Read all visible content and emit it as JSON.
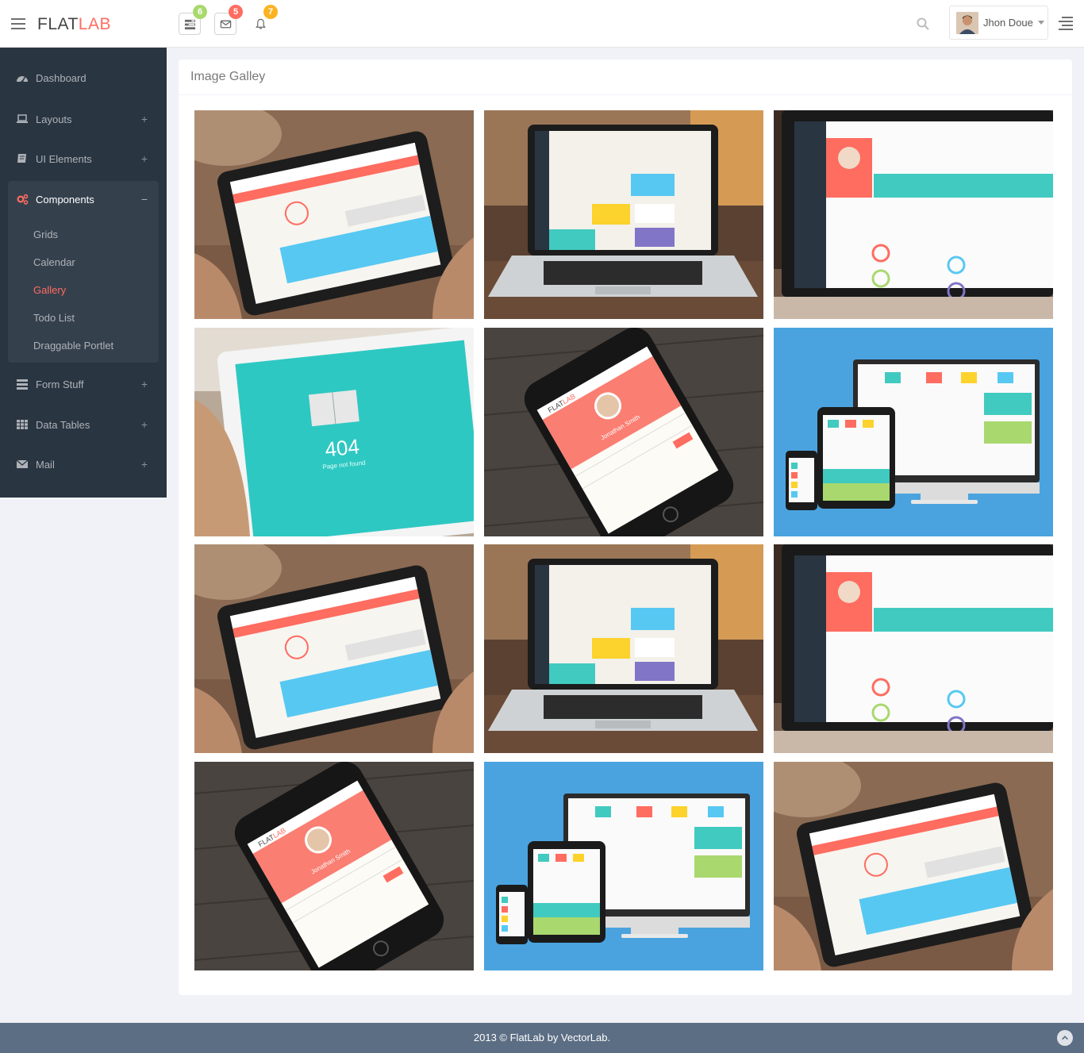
{
  "header": {
    "logo_main": "FLAT",
    "logo_accent": "LAB",
    "notifications": [
      {
        "icon": "tasks-icon",
        "count": "6",
        "color": "#a9d86e"
      },
      {
        "icon": "envelope-icon",
        "count": "5",
        "color": "#ff6c60"
      },
      {
        "icon": "bell-icon",
        "count": "7",
        "color": "#fcb322"
      }
    ],
    "user_name": "Jhon Doue"
  },
  "sidebar": {
    "items": [
      {
        "label": "Dashboard",
        "icon": "dashboard-icon"
      },
      {
        "label": "Layouts",
        "icon": "laptop-icon",
        "expander": "+"
      },
      {
        "label": "UI Elements",
        "icon": "book-icon",
        "expander": "+"
      },
      {
        "label": "Components",
        "icon": "cogs-icon",
        "expander": "−"
      },
      {
        "label": "Form Stuff",
        "icon": "tasks-icon",
        "expander": "+"
      },
      {
        "label": "Data Tables",
        "icon": "table-icon",
        "expander": "+"
      },
      {
        "label": "Mail",
        "icon": "envelope-icon",
        "expander": "+"
      }
    ],
    "components_sub": [
      "Grids",
      "Calendar",
      "Gallery",
      "Todo List",
      "Draggable Portlet"
    ],
    "active_sub": "Gallery"
  },
  "main": {
    "panel_title": "Image Galley",
    "gallery": [
      {
        "type": "tablet-hands"
      },
      {
        "type": "laptop-desk"
      },
      {
        "type": "laptop-profile"
      },
      {
        "type": "tablet-404",
        "text_main": "404",
        "text_sub": "Page not found"
      },
      {
        "type": "phone-profile",
        "person": "Jonathan Smith",
        "logo_main": "FLAT",
        "logo_accent": "LAB"
      },
      {
        "type": "responsive-devices"
      },
      {
        "type": "tablet-hands"
      },
      {
        "type": "laptop-desk"
      },
      {
        "type": "laptop-profile"
      },
      {
        "type": "phone-profile",
        "person": "Jonathan Smith",
        "logo_main": "FLAT",
        "logo_accent": "LAB"
      },
      {
        "type": "responsive-devices"
      },
      {
        "type": "tablet-hands"
      }
    ]
  },
  "footer": {
    "text": "2013 © FlatLab by VectorLab."
  },
  "colors": {
    "sidebar_bg": "#2a3542",
    "accent": "#ff6c60",
    "footer_bg": "#5c6e84"
  }
}
